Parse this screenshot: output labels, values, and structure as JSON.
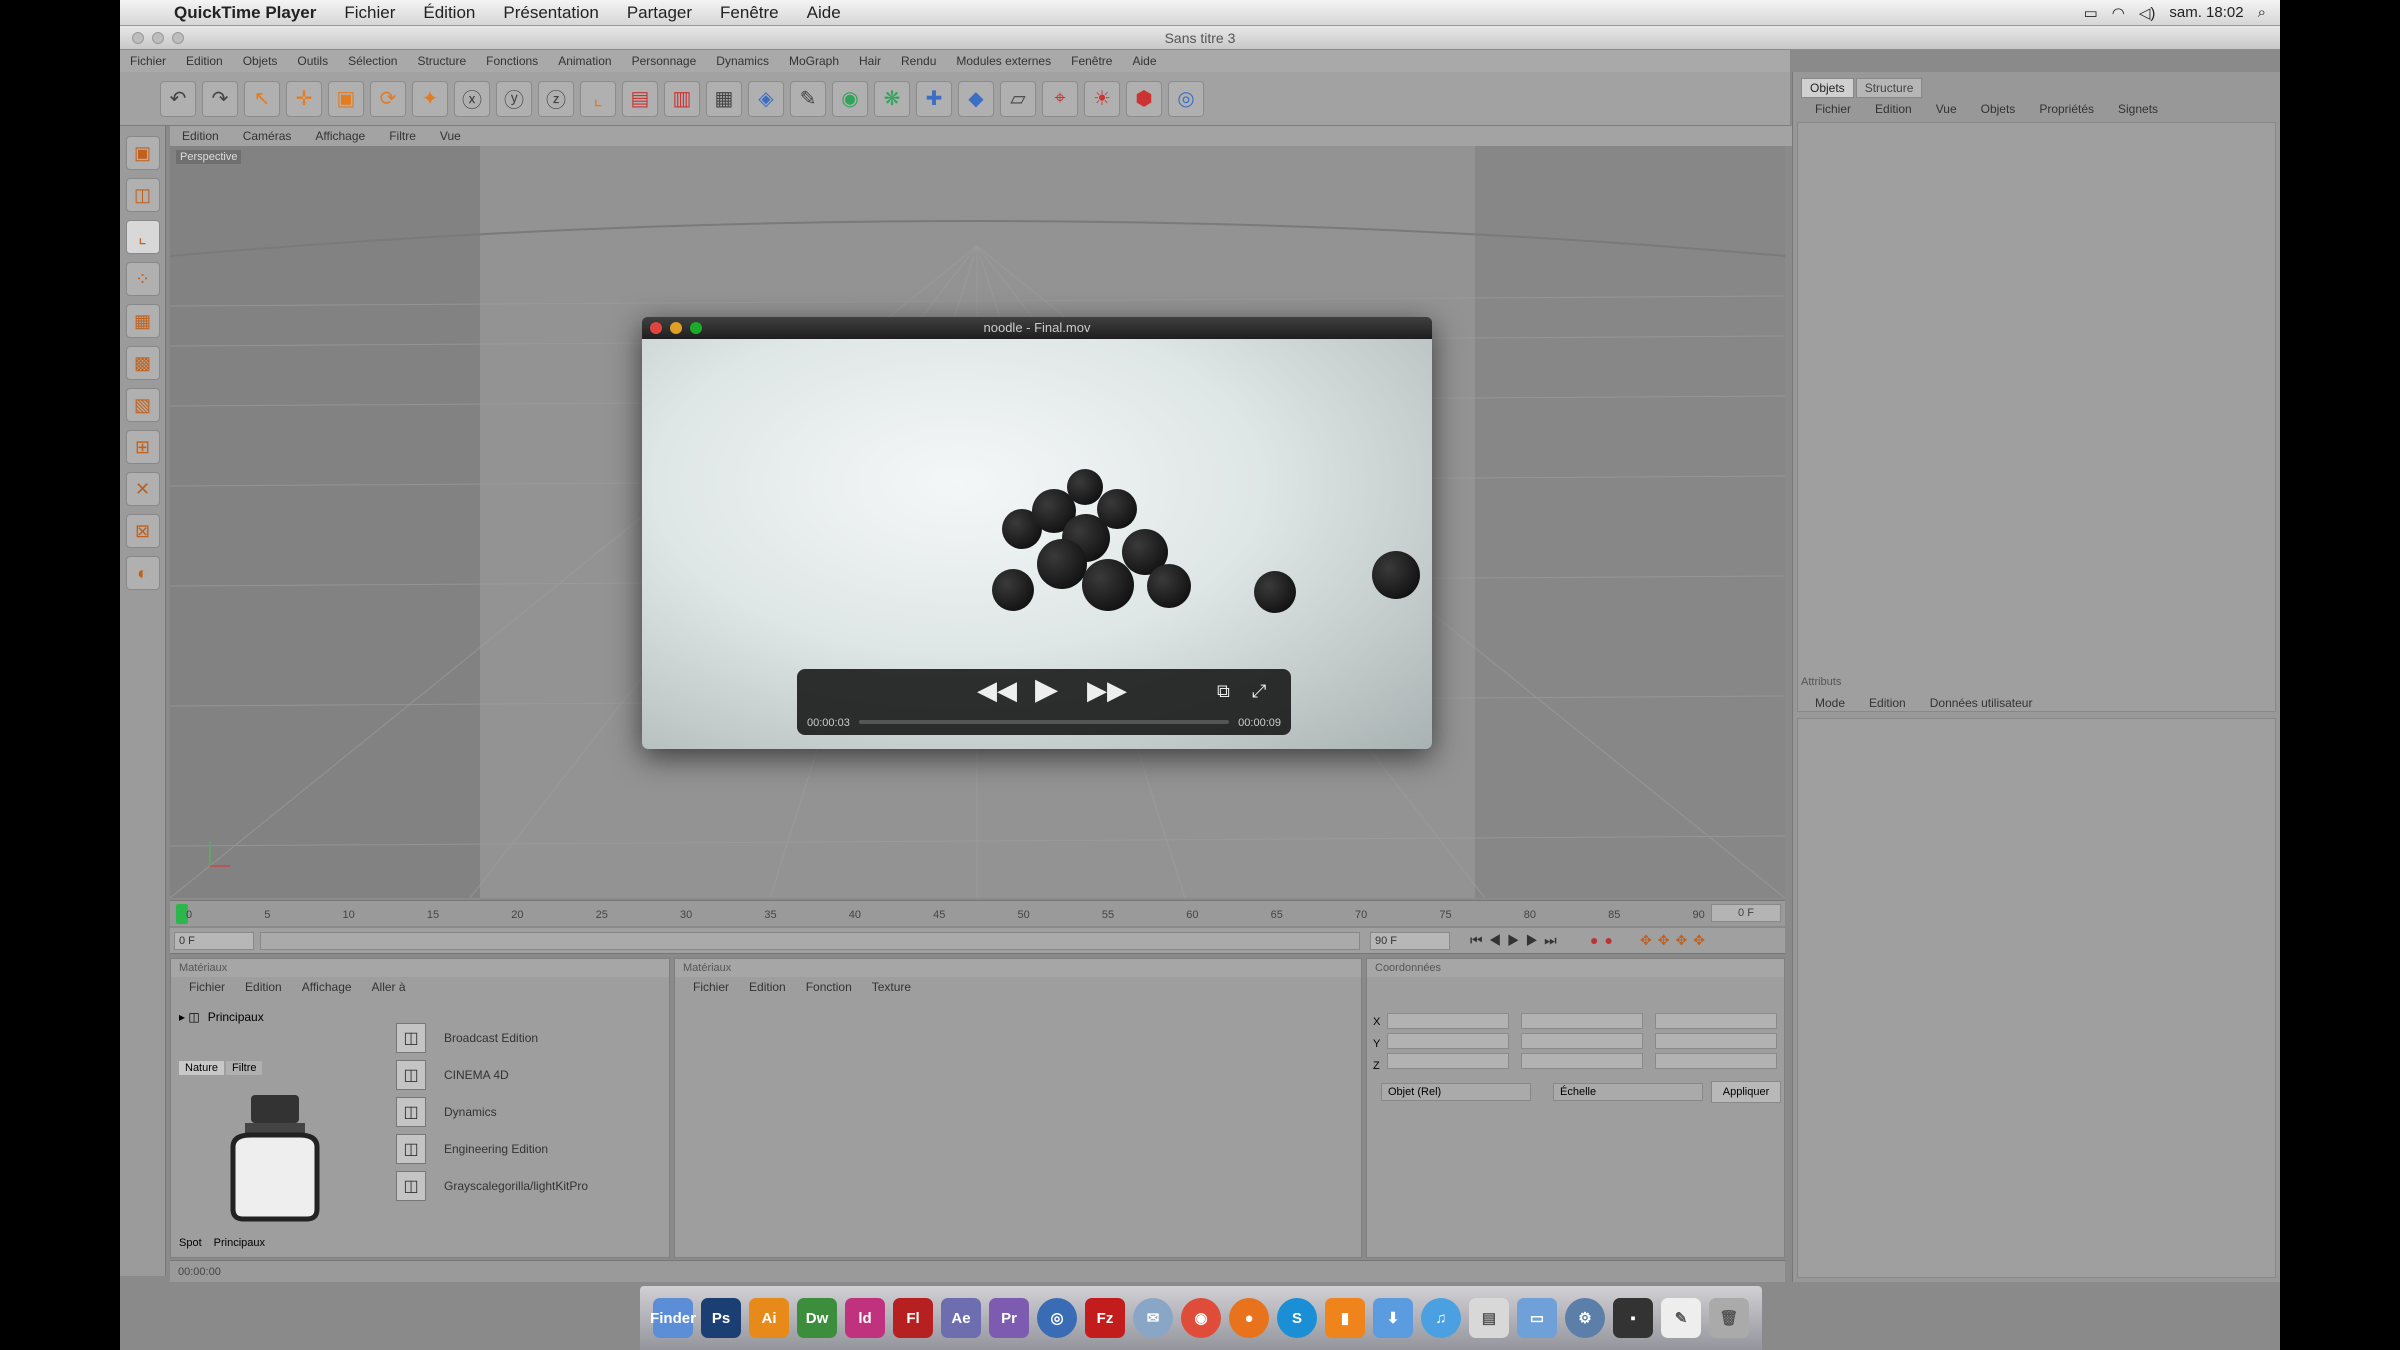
{
  "menubar": {
    "apple": "",
    "app": "QuickTime Player",
    "items": [
      "Fichier",
      "Édition",
      "Présentation",
      "Partager",
      "Fenêtre",
      "Aide"
    ],
    "clock": "sam. 18:02"
  },
  "window": {
    "title": "Sans titre 3"
  },
  "c4d_menu": [
    "Fichier",
    "Edition",
    "Objets",
    "Outils",
    "Sélection",
    "Structure",
    "Fonctions",
    "Animation",
    "Personnage",
    "Dynamics",
    "MoGraph",
    "Hair",
    "Rendu",
    "Modules externes",
    "Fenêtre",
    "Aide"
  ],
  "viewport": {
    "menu": [
      "Edition",
      "Caméras",
      "Affichage",
      "Filtre",
      "Vue"
    ],
    "label": "Perspective"
  },
  "quicktime": {
    "title": "noodle - Final.mov",
    "time_elapsed": "00:00:03",
    "time_remaining": "00:00:09"
  },
  "timeline": {
    "ticks": [
      "0",
      "5",
      "10",
      "15",
      "20",
      "25",
      "30",
      "35",
      "40",
      "45",
      "50",
      "55",
      "60",
      "65",
      "70",
      "75",
      "80",
      "85",
      "90"
    ],
    "end_field": "0 F",
    "start_field": "0 F",
    "end_frame": "90 F"
  },
  "materials": {
    "title": "Matériaux",
    "menu": [
      "Fichier",
      "Edition",
      "Affichage",
      "Aller à"
    ],
    "current": "Principaux",
    "tabs": [
      "Nature",
      "Filtre"
    ],
    "bottom_label": "Spot",
    "bottom_value": "Principaux",
    "items": [
      "Broadcast Edition",
      "CINEMA 4D",
      "Dynamics",
      "Engineering Edition",
      "Grayscalegorilla/lightKitPro"
    ]
  },
  "material_manager": {
    "title": "Matériaux",
    "menu": [
      "Fichier",
      "Edition",
      "Fonction",
      "Texture"
    ]
  },
  "coordinates": {
    "title": "Coordonnées",
    "rows": [
      "X",
      "Y",
      "Z"
    ],
    "dropdown1": "Objet (Rel)",
    "dropdown2": "Échelle",
    "apply": "Appliquer"
  },
  "objects_panel": {
    "tabs": [
      "Objets",
      "Structure"
    ],
    "menu": [
      "Fichier",
      "Edition",
      "Vue",
      "Objets",
      "Propriétés",
      "Signets"
    ]
  },
  "attributes_panel": {
    "title": "Attributs",
    "menu": [
      "Mode",
      "Edition",
      "Données utilisateur"
    ]
  },
  "statusline": {
    "text": "00:00:00"
  },
  "dock": {
    "apps": [
      "Finder",
      "Ps",
      "Ai",
      "Dw",
      "ld",
      "Fl",
      "Ae",
      "Pr",
      "Safari",
      "FileZilla",
      "Mail",
      "Chrome",
      "Firefox",
      "Skype",
      "App",
      "Downloads",
      "iTunes",
      "Preview",
      "Folder",
      "System Preferences",
      "Terminal",
      "TextEdit",
      "Trash"
    ]
  }
}
